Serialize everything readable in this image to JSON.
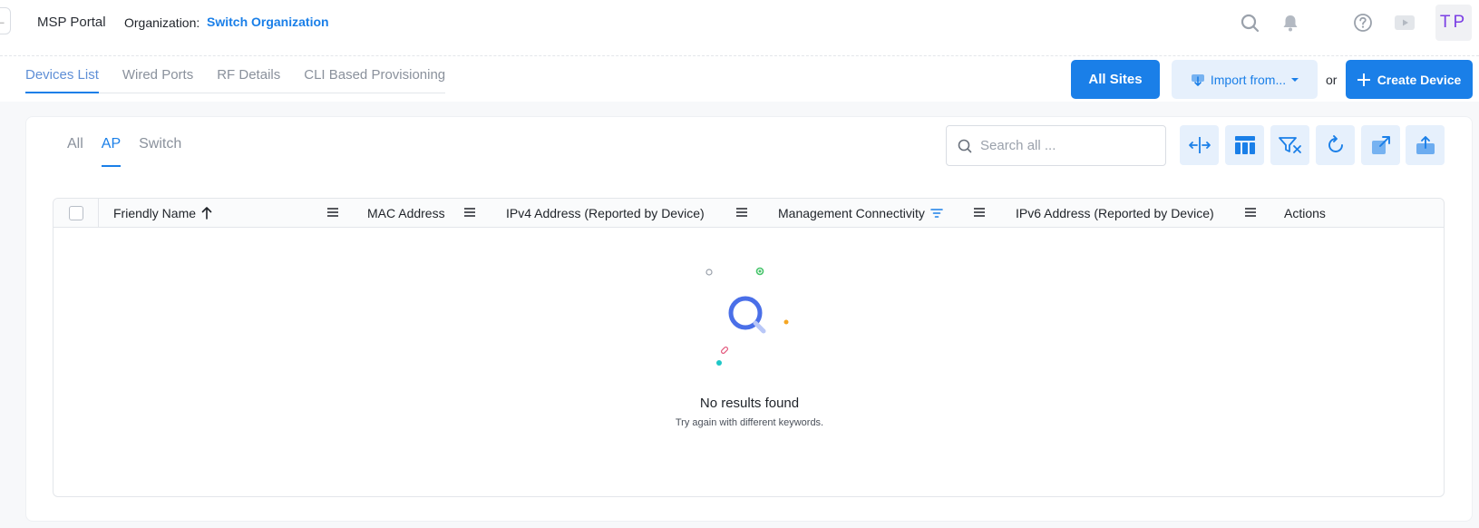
{
  "header": {
    "back_glyph": "←",
    "app_title": "MSP Portal",
    "org_label": "Organization:",
    "org_link": "Switch Organization",
    "avatar_initials": "TP",
    "icons": [
      "search-icon",
      "bell-icon",
      "help-icon",
      "video-icon"
    ]
  },
  "page_tabs": [
    {
      "label": "Devices List",
      "active": true
    },
    {
      "label": "Wired Ports",
      "active": false
    },
    {
      "label": "RF Details",
      "active": false
    },
    {
      "label": "CLI Based Provisioning",
      "active": false
    }
  ],
  "actions": {
    "all_sites": "All Sites",
    "import_from": "Import from...",
    "or": "or",
    "create_device": "Create Device"
  },
  "type_tabs": [
    {
      "label": "All",
      "active": false
    },
    {
      "label": "AP",
      "active": true
    },
    {
      "label": "Switch",
      "active": false
    }
  ],
  "search": {
    "placeholder": "Search all ...",
    "value": ""
  },
  "toolbar_icons": [
    "resize-columns-icon",
    "column-layout-icon",
    "clear-filter-icon",
    "refresh-icon",
    "open-external-icon",
    "export-icon"
  ],
  "table": {
    "columns": [
      {
        "label": "Friendly Name",
        "sort": "ascending"
      },
      {
        "label": "MAC Address"
      },
      {
        "label": "IPv4 Address (Reported by Device)"
      },
      {
        "label": "Management Connectivity",
        "filtered": true
      },
      {
        "label": "IPv6 Address (Reported by Device)"
      },
      {
        "label": "Actions"
      }
    ],
    "rows": []
  },
  "empty_state": {
    "title": "No results found",
    "subtitle": "Try again with different keywords."
  },
  "colors": {
    "accent": "#1a7fe8",
    "accent_light": "#e6f0fc",
    "avatar_text": "#7b3fe4"
  }
}
